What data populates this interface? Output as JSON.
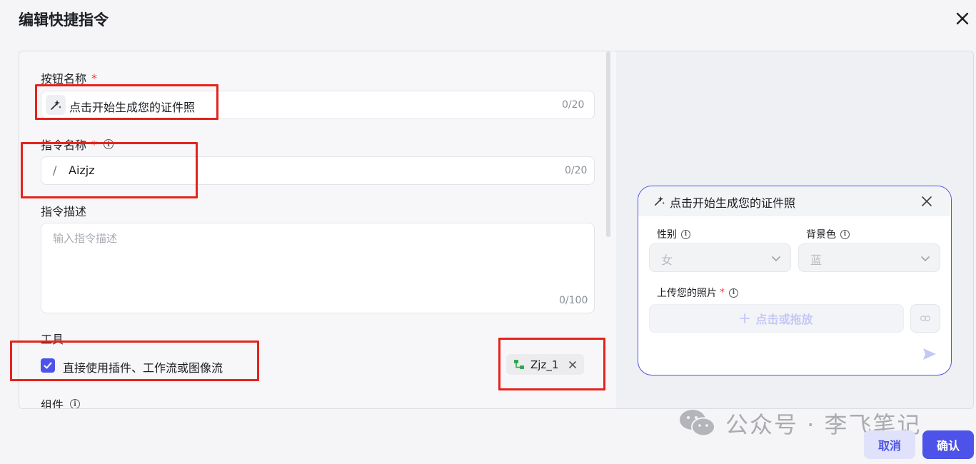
{
  "dialog": {
    "title": "编辑快捷指令",
    "cancel_label": "取消",
    "confirm_label": "确认"
  },
  "form": {
    "button_name": {
      "label": "按钮名称",
      "required_mark": "*",
      "value": "点击开始生成您的证件照",
      "count": "0/20"
    },
    "command_name": {
      "label": "指令名称",
      "required_mark": "*",
      "prefix": "/",
      "value": "Aizjz",
      "count": "0/20"
    },
    "command_desc": {
      "label": "指令描述",
      "placeholder": "输入指令描述",
      "count": "0/100"
    },
    "tools": {
      "label": "工具",
      "checkbox_label": "直接使用插件、工作流或图像流",
      "checked": true,
      "chip_label": "Zjz_1"
    },
    "components": {
      "label": "组件"
    }
  },
  "preview": {
    "title": "点击开始生成您的证件照",
    "gender_label": "性别",
    "gender_value": "女",
    "bg_label": "背景色",
    "bg_value": "蓝",
    "upload_label": "上传您的照片",
    "upload_required": "*",
    "upload_button": "点击或拖放"
  },
  "watermark": {
    "text": "公众号 · 李飞笔记"
  },
  "colors": {
    "accent": "#4d53e8",
    "required": "#f53f3f",
    "highlight": "#e4231c"
  }
}
